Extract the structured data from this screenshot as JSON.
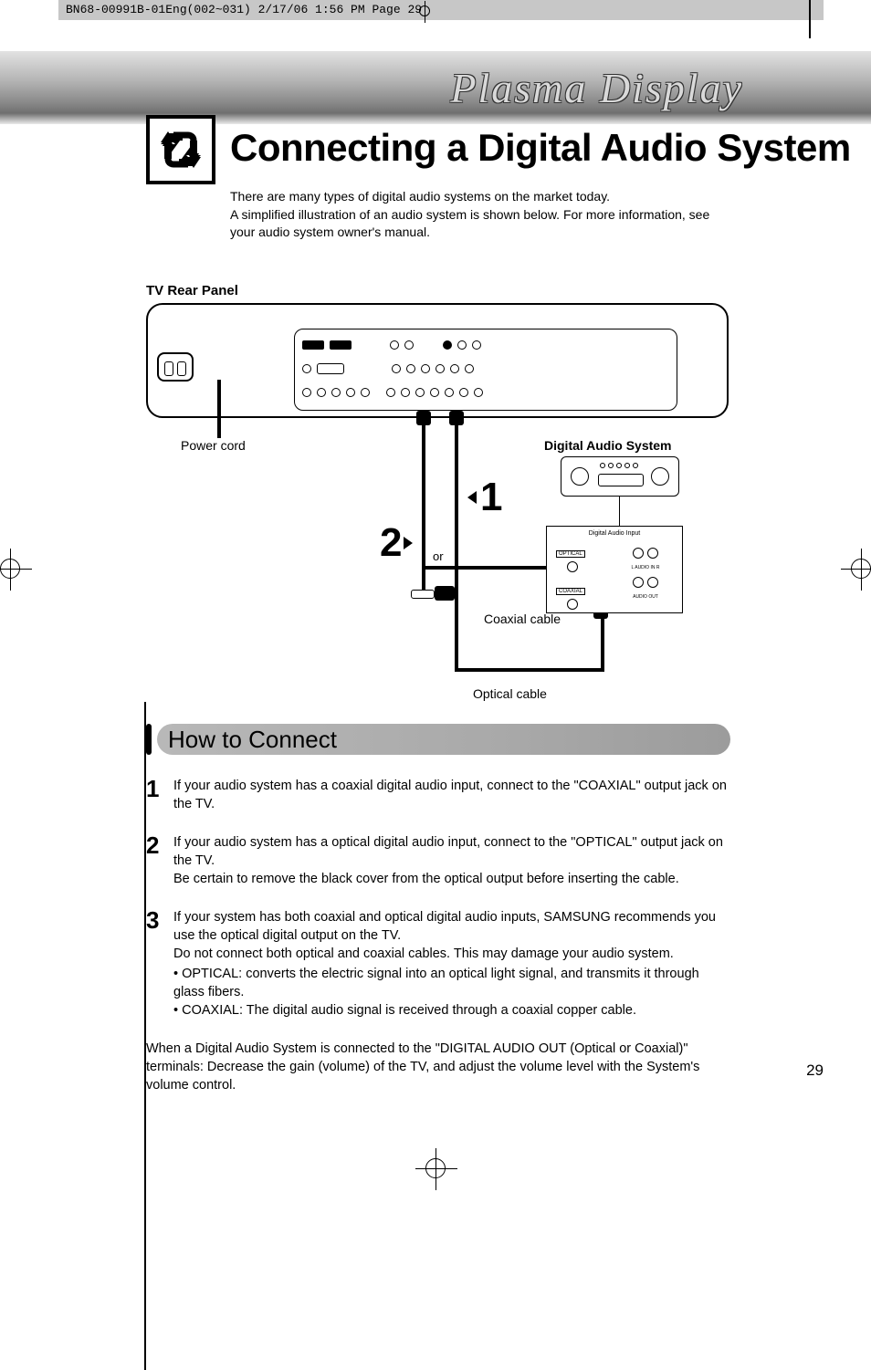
{
  "header_strip": "BN68-00991B-01Eng(002~031)  2/17/06  1:56 PM  Page 29",
  "band_title": "Plasma Display",
  "main_title": "Connecting a Digital Audio System",
  "intro_line1": "There are many types of digital audio systems on the market today.",
  "intro_line2": "A simplified illustration of an audio system is shown below. For more information, see your audio system owner's manual.",
  "tv_rear_label": "TV Rear Panel",
  "diagram": {
    "power_cord": "Power cord",
    "digital_audio_system": "Digital Audio System",
    "num1": "1",
    "num2": "2",
    "or": "or",
    "coaxial_cable": "Coaxial cable",
    "optical_cable": "Optical cable",
    "input_title": "Digital Audio Input",
    "port_optical": "OPTICAL",
    "port_coaxial": "COAXIAL",
    "port_audio_in": "L  AUDIO IN  R",
    "port_audio_out": "AUDIO OUT"
  },
  "how_to": {
    "title": "How to Connect",
    "steps": [
      {
        "num": "1",
        "text": "If your audio system has a coaxial digital audio input, connect to the \"COAXIAL\" output jack on the TV."
      },
      {
        "num": "2",
        "text": "If your audio system has a optical digital audio input, connect to the \"OPTICAL\" output jack on the TV.",
        "text2": "Be certain to remove the black cover from the optical output before inserting the cable."
      },
      {
        "num": "3",
        "text": "If your system has both coaxial and optical digital audio inputs, SAMSUNG recommends you use the optical digital output on the TV.",
        "text2": "Do not connect both optical and coaxial cables. This may damage your audio system.",
        "bullets": [
          "OPTICAL:  converts the electric signal into an optical light signal, and transmits it through glass fibers.",
          "COAXIAL: The digital audio signal is received through a coaxial copper cable."
        ]
      }
    ],
    "footer": "When a Digital Audio System is connected to the \"DIGITAL AUDIO OUT (Optical or Coaxial)\" terminals: Decrease the gain (volume) of the TV, and adjust the volume level with the System's volume control."
  },
  "page_number": "29"
}
